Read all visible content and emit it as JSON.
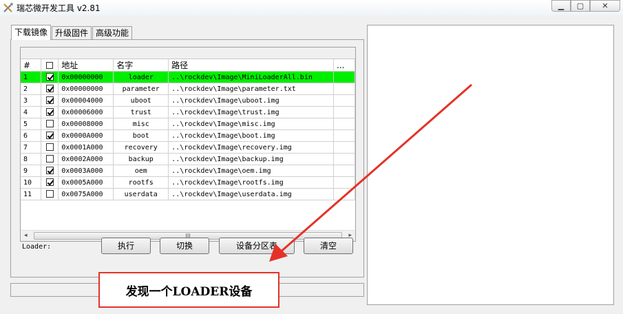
{
  "window": {
    "title": "瑞芯微开发工具 v2.81"
  },
  "tabs": [
    {
      "label": "下载镜像"
    },
    {
      "label": "升级固件"
    },
    {
      "label": "高级功能"
    }
  ],
  "table": {
    "columns": [
      "#",
      "",
      "地址",
      "名字",
      "路径",
      "..."
    ],
    "rows": [
      {
        "num": "1",
        "checked": true,
        "address": "0x00000000",
        "name": "loader",
        "path": "..\\rockdev\\Image\\MiniLoaderAll.bin",
        "selected": true
      },
      {
        "num": "2",
        "checked": true,
        "address": "0x00000000",
        "name": "parameter",
        "path": "..\\rockdev\\Image\\parameter.txt"
      },
      {
        "num": "3",
        "checked": true,
        "address": "0x00004000",
        "name": "uboot",
        "path": "..\\rockdev\\Image\\uboot.img"
      },
      {
        "num": "4",
        "checked": true,
        "address": "0x00006000",
        "name": "trust",
        "path": "..\\rockdev\\Image\\trust.img"
      },
      {
        "num": "5",
        "checked": false,
        "address": "0x00008000",
        "name": "misc",
        "path": "..\\rockdev\\Image\\misc.img"
      },
      {
        "num": "6",
        "checked": true,
        "address": "0x0000A000",
        "name": "boot",
        "path": "..\\rockdev\\Image\\boot.img"
      },
      {
        "num": "7",
        "checked": false,
        "address": "0x0001A000",
        "name": "recovery",
        "path": "..\\rockdev\\Image\\recovery.img"
      },
      {
        "num": "8",
        "checked": false,
        "address": "0x0002A000",
        "name": "backup",
        "path": "..\\rockdev\\Image\\backup.img"
      },
      {
        "num": "9",
        "checked": true,
        "address": "0x0003A000",
        "name": "oem",
        "path": "..\\rockdev\\Image\\oem.img"
      },
      {
        "num": "10",
        "checked": true,
        "address": "0x0005A000",
        "name": "rootfs",
        "path": "..\\rockdev\\Image\\rootfs.img"
      },
      {
        "num": "11",
        "checked": false,
        "address": "0x0075A000",
        "name": "userdata",
        "path": "..\\rockdev\\Image\\userdata.img"
      }
    ]
  },
  "scrollbar": {
    "grip": "III",
    "left_arrow": "◂",
    "right_arrow": "▸"
  },
  "loader_label": "Loader:",
  "buttons": {
    "execute": "执行",
    "switch": "切换",
    "partition_table": "设备分区表",
    "clear": "清空"
  },
  "callout": {
    "text": "发现一个LOADER设备"
  },
  "colors": {
    "selected_row": "#00ee00",
    "annotation": "#e53228"
  }
}
